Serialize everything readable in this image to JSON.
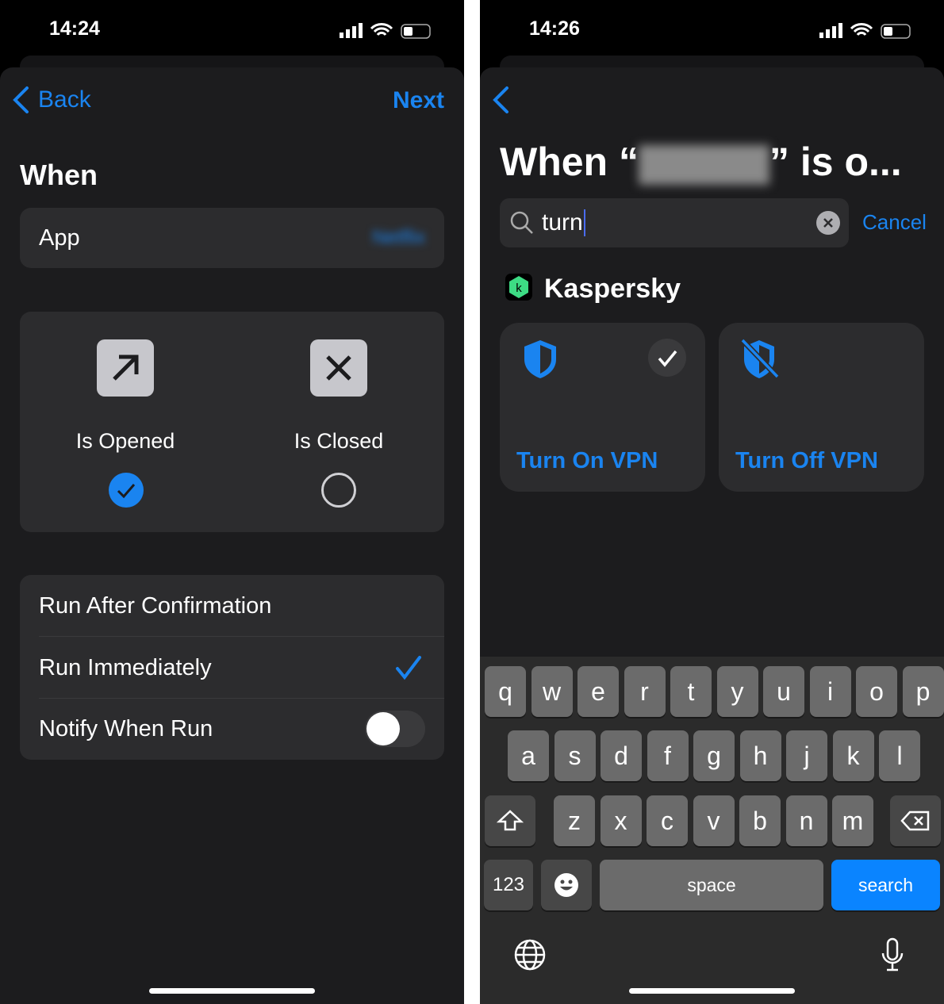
{
  "left": {
    "status_time": "14:24",
    "back_label": "Back",
    "next_label": "Next",
    "title": "When",
    "app_label": "App",
    "app_value": "Netflix",
    "opened_label": "Is Opened",
    "closed_label": "Is Closed",
    "opened_selected": true,
    "options": [
      "Run After Confirmation",
      "Run Immediately",
      "Notify When Run"
    ],
    "selected_option": "Run Immediately",
    "notify_toggle": false
  },
  "right": {
    "status_time": "14:26",
    "title_prefix": "When “",
    "title_suffix": "” is o...",
    "search_value": "turn",
    "cancel_label": "Cancel",
    "app_name": "Kaspersky",
    "actions": [
      "Turn On VPN",
      "Turn Off VPN"
    ],
    "keyboard": {
      "row1": [
        "q",
        "w",
        "e",
        "r",
        "t",
        "y",
        "u",
        "i",
        "o",
        "p"
      ],
      "row2": [
        "a",
        "s",
        "d",
        "f",
        "g",
        "h",
        "j",
        "k",
        "l"
      ],
      "row3": [
        "z",
        "x",
        "c",
        "v",
        "b",
        "n",
        "m"
      ],
      "numbers": "123",
      "space": "space",
      "search": "search"
    }
  },
  "colors": {
    "accent": "#1a84f0",
    "card": "#2c2c2e",
    "sheet": "#1c1c1e",
    "kaspersky": "#3ddc84"
  }
}
